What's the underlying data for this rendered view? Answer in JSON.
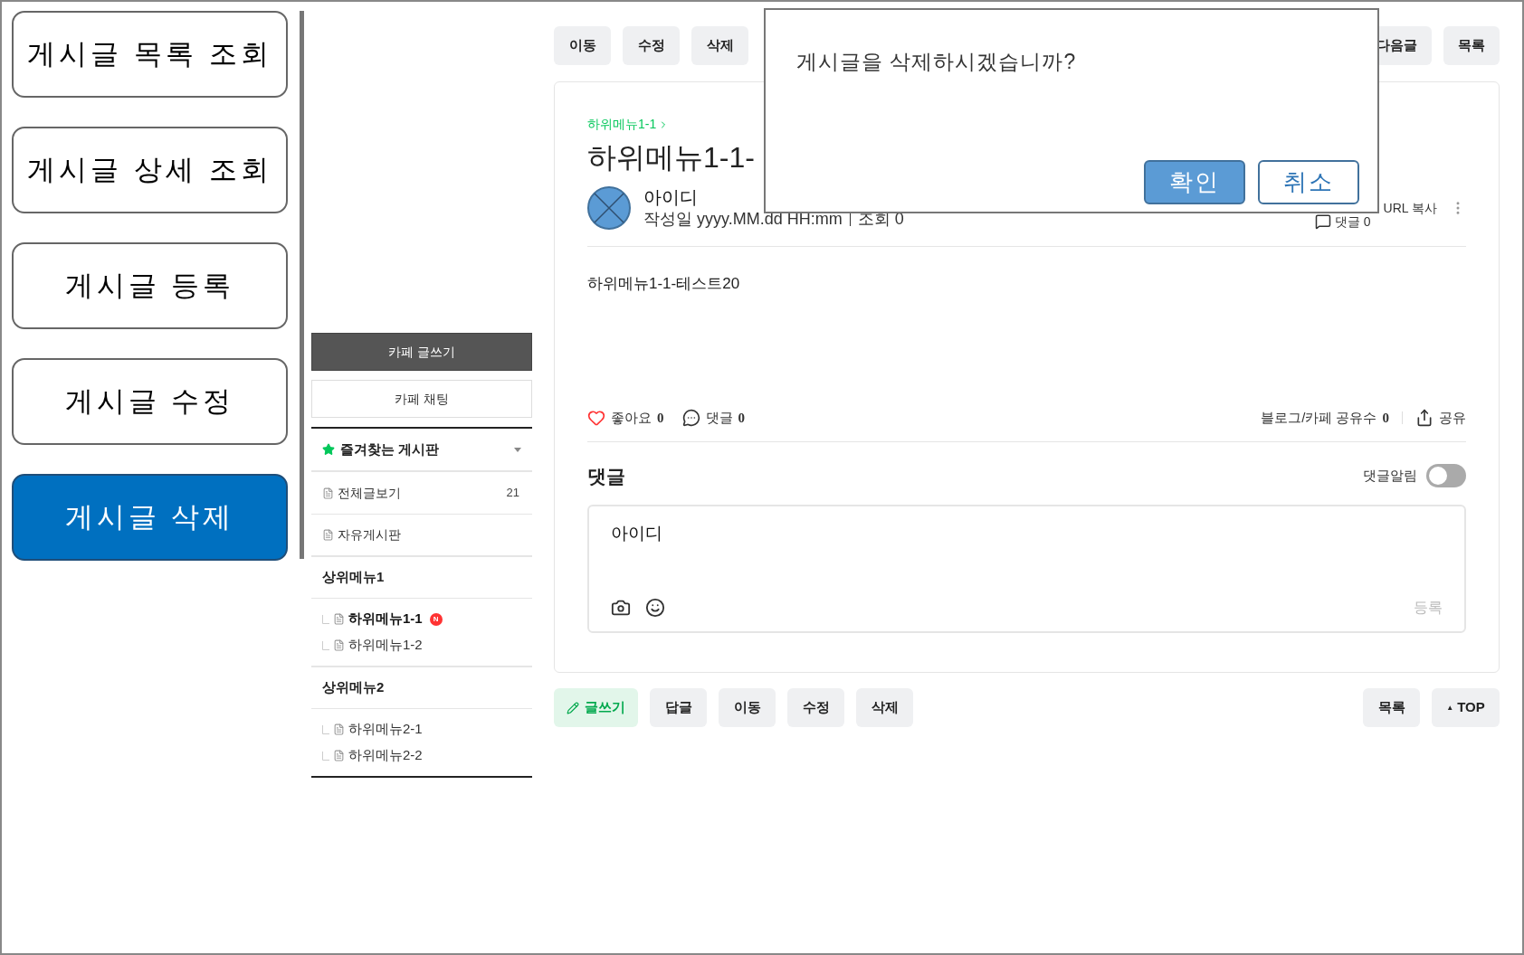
{
  "left_menu": [
    {
      "label": "게시글 목록 조회",
      "selected": false
    },
    {
      "label": "게시글 상세 조회",
      "selected": false
    },
    {
      "label": "게시글 등록",
      "selected": false
    },
    {
      "label": "게시글 수정",
      "selected": false
    },
    {
      "label": "게시글 삭제",
      "selected": true
    }
  ],
  "sidebar": {
    "write_button": "카페 글쓰기",
    "chat_button": "카페 채팅",
    "favorites": "즐겨찾는 게시판",
    "boards": [
      {
        "label": "전체글보기",
        "count": "21"
      },
      {
        "label": "자유게시판"
      }
    ],
    "groups": [
      {
        "title": "상위메뉴1",
        "items": [
          {
            "label": "하위메뉴1-1",
            "selected": true,
            "badge": "N"
          },
          {
            "label": "하위메뉴1-2",
            "selected": false
          }
        ]
      },
      {
        "title": "상위메뉴2",
        "items": [
          {
            "label": "하위메뉴2-1",
            "selected": false
          },
          {
            "label": "하위메뉴2-2",
            "selected": false
          }
        ]
      }
    ]
  },
  "top_actions": [
    "이동",
    "수정",
    "삭제"
  ],
  "top_nav": [
    "다음글",
    "목록"
  ],
  "post": {
    "breadcrumb": "하위메뉴1-1",
    "title": "하위메뉴1-1-",
    "author": "아이디",
    "date": "작성일 yyyy.MM.dd HH:mm",
    "views": "조회 0",
    "comment_count": "댓글 0",
    "url_copy": "URL 복사",
    "body": "하위메뉴1-1-테스트20",
    "likes_label": "좋아요",
    "likes": "0",
    "comments_label": "댓글",
    "comments": "0",
    "shares_label": "블로그/카페 공유수",
    "shares": "0",
    "share": "공유"
  },
  "comments": {
    "title": "댓글",
    "notify_label": "댓글알림",
    "notify_on": false,
    "author": "아이디",
    "submit": "등록"
  },
  "bottom_actions": [
    {
      "label": "글쓰기",
      "kind": "write"
    },
    {
      "label": "답글",
      "kind": "plain"
    },
    {
      "label": "이동",
      "kind": "plain"
    },
    {
      "label": "수정",
      "kind": "plain"
    },
    {
      "label": "삭제",
      "kind": "plain"
    }
  ],
  "bottom_nav": [
    {
      "label": "목록",
      "kind": "plain"
    },
    {
      "label": "TOP",
      "kind": "top",
      "icon": "▲"
    }
  ],
  "dialog": {
    "message": "게시글을 삭제하시겠습니까?",
    "confirm": "확인",
    "cancel": "취소"
  }
}
